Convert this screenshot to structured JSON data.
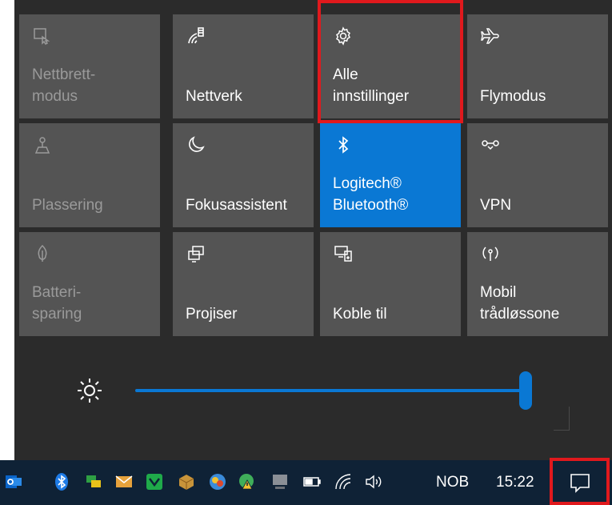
{
  "quick_actions": [
    {
      "id": "tablet",
      "label": "Nettbrett-\nmodus",
      "icon": "tablet-mode-icon",
      "state": "disabled"
    },
    {
      "id": "network",
      "label": "Nettverk",
      "icon": "network-icon",
      "state": "normal"
    },
    {
      "id": "settings",
      "label": "Alle\ninnstillinger",
      "icon": "gear-icon",
      "state": "normal"
    },
    {
      "id": "airplane",
      "label": "Flymodus",
      "icon": "airplane-icon",
      "state": "normal"
    },
    {
      "id": "location",
      "label": "Plassering",
      "icon": "location-icon",
      "state": "disabled"
    },
    {
      "id": "focus",
      "label": "Fokusassistent",
      "icon": "moon-icon",
      "state": "normal"
    },
    {
      "id": "bluetooth",
      "label": "Logitech®\nBluetooth®",
      "icon": "bluetooth-icon",
      "state": "active"
    },
    {
      "id": "vpn",
      "label": "VPN",
      "icon": "vpn-icon",
      "state": "normal"
    },
    {
      "id": "battery",
      "label": "Batteri-\nsparing",
      "icon": "battery-saver-icon",
      "state": "disabled"
    },
    {
      "id": "project",
      "label": "Projiser",
      "icon": "project-icon",
      "state": "normal"
    },
    {
      "id": "connect",
      "label": "Koble til",
      "icon": "connect-icon",
      "state": "normal"
    },
    {
      "id": "hotspot",
      "label": "Mobil\ntrådløssone",
      "icon": "mobile-hotspot-icon",
      "state": "normal"
    }
  ],
  "brightness": {
    "level_percent": 100,
    "icon": "brightness-icon"
  },
  "taskbar": {
    "language": "NOB",
    "time": "15:22"
  },
  "colors": {
    "panel_bg": "#2b2b2b",
    "tile_bg": "#545454",
    "active_tile": "#0a78d4",
    "highlight": "#e0191d",
    "taskbar_bg": "#0f2236"
  }
}
